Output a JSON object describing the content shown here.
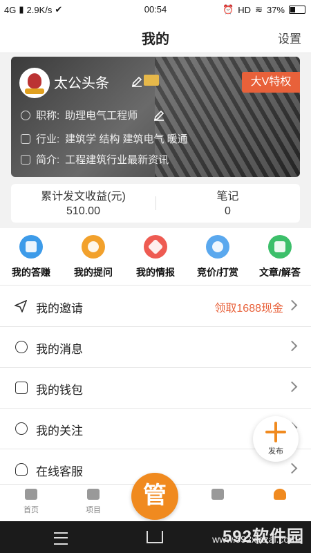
{
  "status": {
    "network": "4G",
    "speed": "2.9K/s",
    "time": "00:54",
    "hd": "HD",
    "battery": "37%"
  },
  "header": {
    "title": "我的",
    "settings": "设置"
  },
  "profile": {
    "name": "太公头条",
    "vip": "大V特权",
    "title_label": "职称:",
    "title_value": "助理电气工程师",
    "industry_label": "行业:",
    "industry_value": "建筑学 结构 建筑电气 暖通",
    "intro_label": "简介:",
    "intro_value": "工程建筑行业最新资讯"
  },
  "stats": [
    {
      "label": "累计发文收益(元)",
      "value": "510.00"
    },
    {
      "label": "笔记",
      "value": "0"
    }
  ],
  "actions": [
    {
      "label": "我的答赚",
      "color": "#3d9be9"
    },
    {
      "label": "我的提问",
      "color": "#f2a12c"
    },
    {
      "label": "我的情报",
      "color": "#ee5b52"
    },
    {
      "label": "竞价/打赏",
      "color": "#5aa8ee"
    },
    {
      "label": "文章/解答",
      "color": "#3cbf6a"
    }
  ],
  "menu": [
    {
      "label": "我的邀请",
      "extra": "领取1688现金"
    },
    {
      "label": "我的消息",
      "extra": ""
    },
    {
      "label": "我的钱包",
      "extra": ""
    },
    {
      "label": "我的关注",
      "extra": ""
    },
    {
      "label": "在线客服",
      "extra": ""
    }
  ],
  "fab": {
    "label": "发布"
  },
  "nav": [
    {
      "label": "首页"
    },
    {
      "label": "项目"
    },
    {
      "label": "管"
    },
    {
      "label": ""
    },
    {
      "label": ""
    }
  ],
  "watermark": {
    "brand": "592软件园",
    "url": "www.592xiazai.com"
  }
}
